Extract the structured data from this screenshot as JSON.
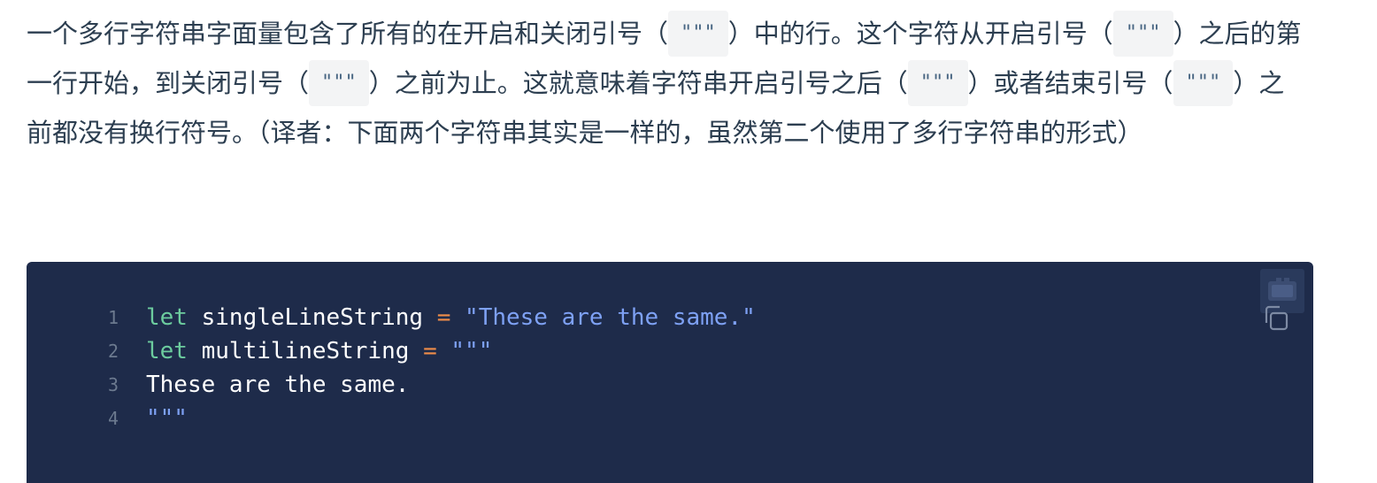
{
  "paragraph": {
    "t1": "一个多行字符串字面量包含了所有的在开启和关闭引号（",
    "c1": "\"\"\"",
    "t2": "）中的行。这个字符从开启引号（",
    "c2": "\"\"\"",
    "t3": "）之后的第一行开始，到关闭引号（",
    "c3": "\"\"\"",
    "t4": "）之前为止。这就意味着字符串开启引号之后（",
    "c4": "\"\"\"",
    "t5": "）或者结束引号（",
    "c5": "\"\"\"",
    "t6": "）之前都没有换行符号。（译者：下面两个字符串其实是一样的，虽然第二个使用了多行字符串的形式）"
  },
  "code": {
    "language": "swift",
    "lines": [
      {
        "num": "1",
        "kw": "let",
        "name": " singleLineString ",
        "op": "=",
        "str": " \"These are the same.\"",
        "plain": ""
      },
      {
        "num": "2",
        "kw": "let",
        "name": " multilineString ",
        "op": "=",
        "str": " \"\"\"",
        "plain": ""
      },
      {
        "num": "3",
        "kw": "",
        "name": "",
        "op": "",
        "str": "",
        "plain": "These are the same."
      },
      {
        "num": "4",
        "kw": "",
        "name": "",
        "op": "",
        "str": "\"\"\"",
        "plain": ""
      }
    ]
  },
  "icons": {
    "copy": "copy-icon",
    "language_badge": "language-badge-icon"
  },
  "colors": {
    "code_bg": "#1e2b4a",
    "keyword": "#6ccb9e",
    "operator": "#f08d49",
    "string": "#7ea1f4",
    "text": "#2c3e50"
  }
}
